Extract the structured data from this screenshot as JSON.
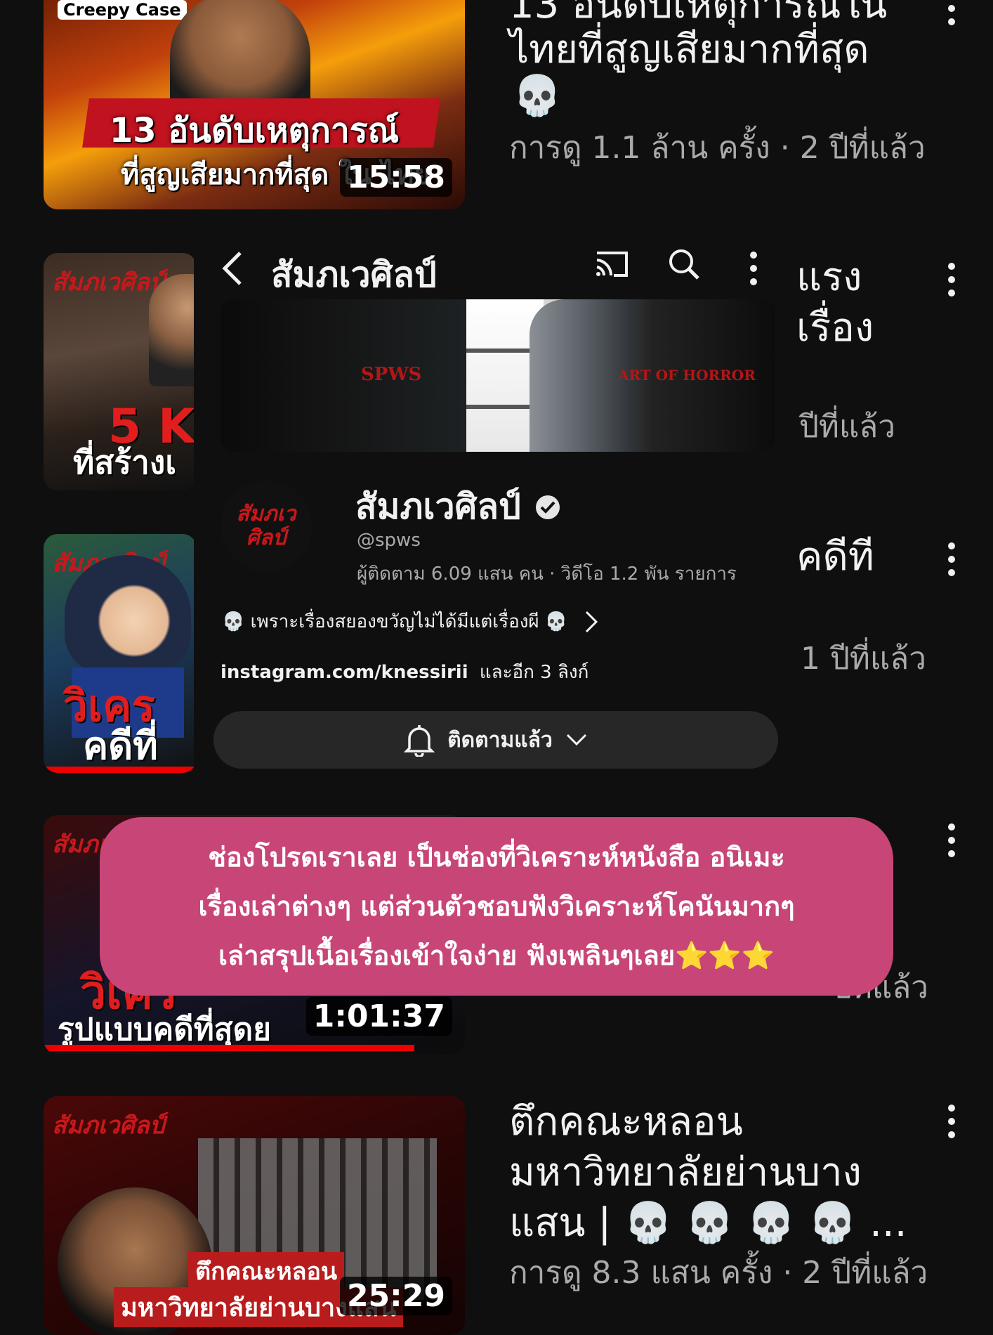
{
  "videos": [
    {
      "thumb_badge": "Creepy Case",
      "thumb_line1": "13 อันดับเหตุการณ์",
      "thumb_line2": "ที่สูญเสียมากที่สุด ใน ไทย",
      "duration": "15:58",
      "title_line1": "13 อันดับเหตุการณ์ใน",
      "title_line2": "ไทยที่สูญเสียมากที่สุด",
      "title_emoji": "💀",
      "meta": "การดู 1.1 ล้าน ครั้ง · 2 ปีที่แล้ว"
    },
    {
      "thumb_line1": "5 K",
      "thumb_line2": "ที่สร้างเ",
      "title_line1": "แรง",
      "title_line2": "เรื่อง",
      "meta": "ปีที่แล้ว"
    },
    {
      "thumb_line1": "วิเคร",
      "thumb_line2": "คดีที่",
      "title_line1": "คดีที",
      "meta": "1 ปีที่แล้ว"
    },
    {
      "thumb_line1": "วิเคร",
      "thumb_line2": "รูปแบบคดีที่สุดย",
      "duration": "1:01:37",
      "meta": "ปีที่แล้ว"
    },
    {
      "thumb_line1": "ตึกคณะหลอน",
      "thumb_line2": "มหาวิทยาลัยย่านบางแสน",
      "duration": "25:29",
      "title_line1": "ตึกคณะหลอน",
      "title_line2": "มหาวิทยาลัยย่านบาง",
      "title_line3": "แสน | 💀 💀 💀 💀 ...",
      "meta": "การดู 8.3 แสน ครั้ง · 2 ปีที่แล้ว"
    }
  ],
  "thumb_logo": "สัมภเวศิลป์",
  "channel": {
    "topbar_title": "สัมภเวศิลป์",
    "banner_left": "SPWS",
    "banner_right": "ART OF HORROR",
    "name": "สัมภเวศิลป์",
    "handle": "@spws",
    "stats": "ผู้ติดตาม 6.09 แสน คน · วิดีโอ 1.2 พัน รายการ",
    "description": "💀 เพราะเรื่องสยองขวัญไม่ได้มีแต่เรื่องผี 💀",
    "link": "instagram.com/knessirii",
    "link_more": "และอีก 3 ลิงก์",
    "subscribed_label": "ติดตามแล้ว"
  },
  "overlay": {
    "line1": "ช่องโปรดเราเลย เป็นช่องที่วิเคราะห์หนังสือ อนิเมะ",
    "line2": "เรื่องเล่าต่างๆ แต่ส่วนตัวชอบฟังวิเคราะห์โคนันมากๆ",
    "line3": "เล่าสรุปเนื้อเรื่องเข้าใจง่าย ฟังเพลินๆเลย⭐⭐⭐"
  },
  "colors": {
    "background": "#0f0f0f",
    "overlay_pink": "#c84677",
    "accent_red": "#e00000"
  }
}
